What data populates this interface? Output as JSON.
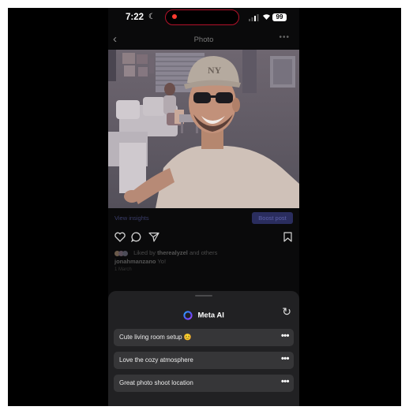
{
  "status_bar": {
    "time": "7:22",
    "battery": "99"
  },
  "nav": {
    "title": "Photo"
  },
  "post": {
    "view_insights": "View insights",
    "boost_post": "Boost post",
    "liked_prefix": "Liked by ",
    "liked_user": "therealyzel",
    "liked_suffix": " and others",
    "caption_user": "jonahmanzano",
    "caption_text": " Yo!",
    "date": "1 March"
  },
  "sheet": {
    "title": "Meta AI",
    "suggestions": [
      {
        "label": "Cute living room setup 😊"
      },
      {
        "label": "Love the cozy atmosphere"
      },
      {
        "label": "Great photo shoot location"
      }
    ]
  }
}
